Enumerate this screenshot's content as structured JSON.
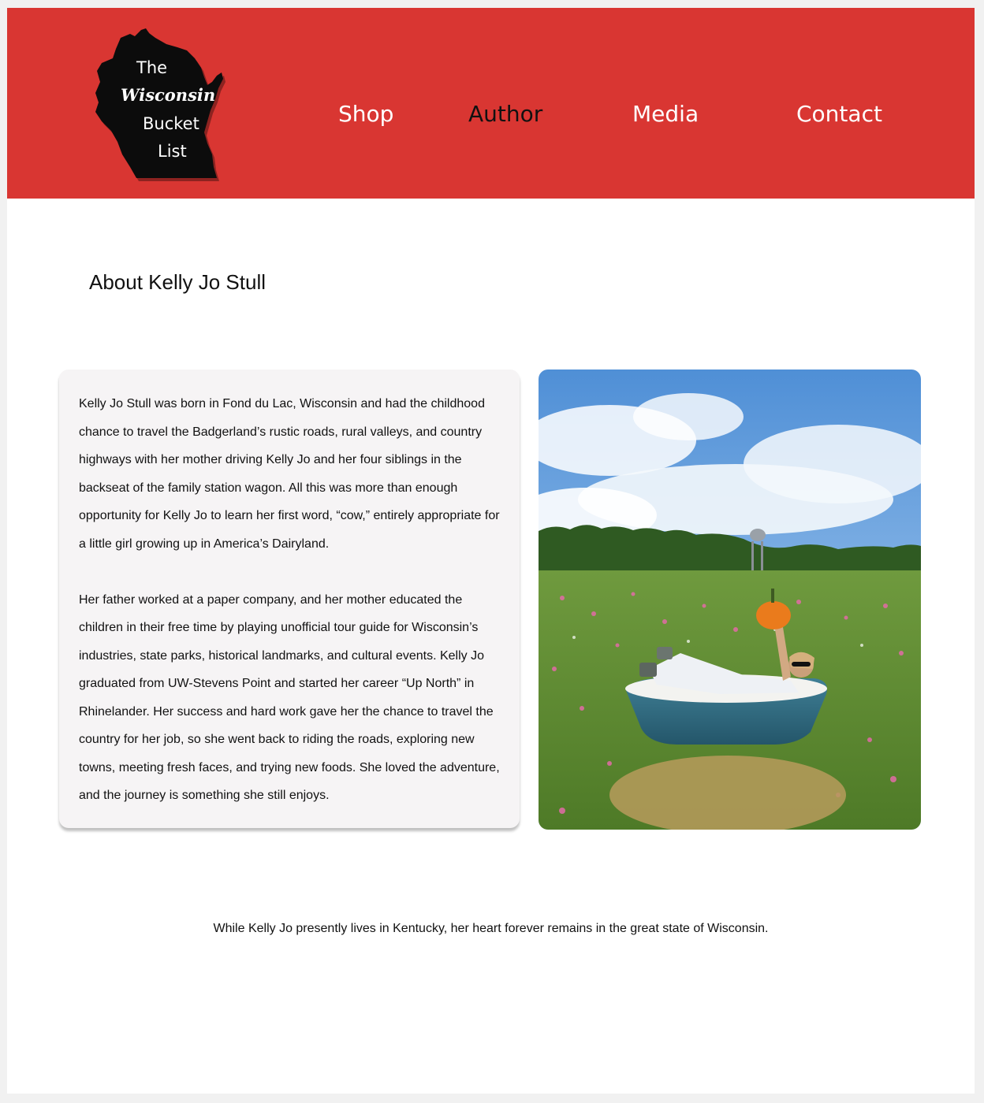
{
  "colors": {
    "header_bg": "#d93632",
    "nav_text": "#ffffff",
    "nav_active": "#111111",
    "card_bg": "#f6f4f5",
    "body_text": "#111111"
  },
  "logo": {
    "line1": "The",
    "line2": "Wisconsin",
    "line3": "Bucket",
    "line4": "List",
    "icon": "wisconsin-state-silhouette-icon"
  },
  "nav": {
    "shop": "Shop",
    "author": "Author",
    "media": "Media",
    "contact": "Contact",
    "active": "Author"
  },
  "page": {
    "title": "About Kelly Jo Stull"
  },
  "bio": {
    "paragraph1": "Kelly Jo Stull was born in Fond du Lac, Wisconsin and had the childhood chance to travel the Badgerland’s rustic roads, rural valleys, and country highways with her mother driving Kelly Jo and her four siblings in the backseat of the family station wagon. All this was more than enough opportunity for Kelly Jo to learn her first word, “cow,” entirely appropriate for a little girl growing up in America’s Dairyland.",
    "paragraph2": "Her father worked at a paper company, and her mother educated the children in their free time by playing unofficial tour guide for Wisconsin’s industries, state parks, historical landmarks, and cultural events. Kelly Jo graduated from UW-Stevens Point and started her career “Up North” in Rhinelander. Her success and hard work gave her the chance to travel the country for her job, so she went back to riding the roads, exploring new towns, meeting fresh faces, and trying new foods. She loved the adventure, and the journey is something she still enjoys."
  },
  "footer": {
    "note": "While Kelly Jo presently lives in Kentucky, her heart forever remains in the great state of Wisconsin."
  }
}
